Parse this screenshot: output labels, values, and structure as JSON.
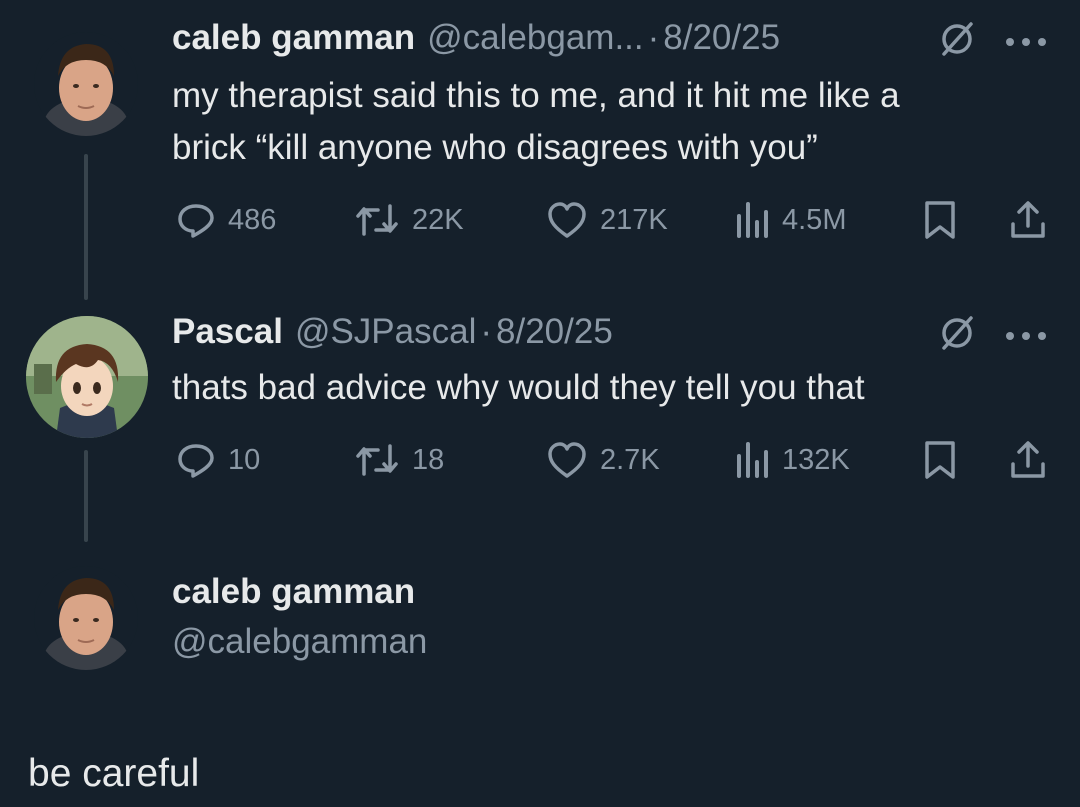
{
  "colors": {
    "background": "#15202b",
    "text": "#e7e9ea",
    "muted": "#8b98a5",
    "thread_line": "#38444d"
  },
  "icons": [
    "reply-icon",
    "retweet-icon",
    "like-icon",
    "views-icon",
    "bookmark-icon",
    "share-icon",
    "grok-icon",
    "more-icon"
  ],
  "tweets": [
    {
      "name": "caleb gamman",
      "handle": "@calebgam...",
      "separator": "·",
      "date": "8/20/25",
      "text_line1": "my therapist said this to me, and it hit me like a",
      "text_line2": "brick “kill anyone who disagrees with you”",
      "replies": "486",
      "reposts": "22K",
      "likes": "217K",
      "views": "4.5M"
    },
    {
      "name": "Pascal",
      "handle": "@SJPascal",
      "separator": "·",
      "date": "8/20/25",
      "text_line1": "thats bad advice why would they tell you that",
      "replies": "10",
      "reposts": "18",
      "likes": "2.7K",
      "views": "132K"
    }
  ],
  "profile": {
    "name": "caleb gamman",
    "handle": "@calebgamman"
  },
  "caption": "be careful"
}
